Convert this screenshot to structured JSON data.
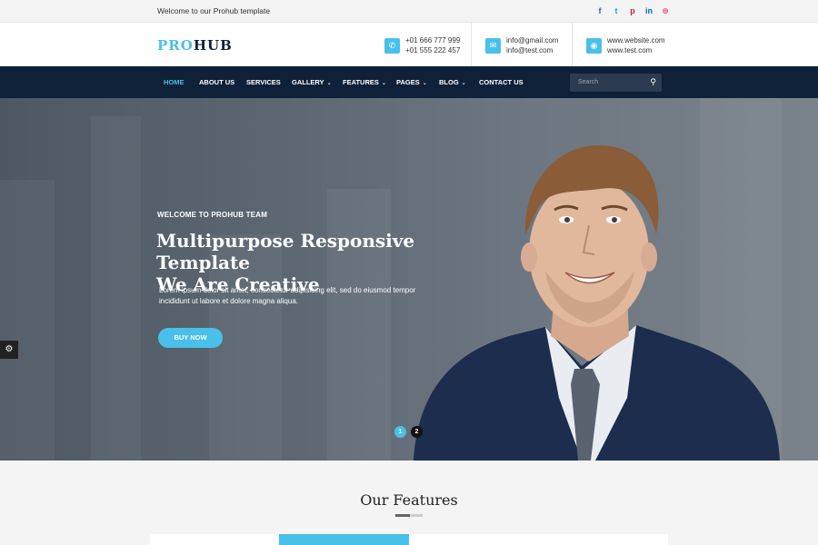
{
  "topbar": {
    "welcome": "Welcome to our Prohub template",
    "social_icons": [
      "facebook-icon",
      "twitter-icon",
      "pinterest-icon",
      "linkedin-icon",
      "dribbble-icon"
    ]
  },
  "header": {
    "logo_pro": "PRO",
    "logo_hub": "HUB",
    "phones": [
      "+01 666 777 999",
      "+01 555 222 457"
    ],
    "emails": [
      "info@gmail.com",
      "info@test.com"
    ],
    "websites": [
      "www.website.com",
      "www.test.com"
    ]
  },
  "nav": {
    "items": [
      "HOME",
      "ABOUT US",
      "SERVICES",
      "GALLERY",
      "FEATURES",
      "PAGES",
      "BLOG",
      "CONTACT US"
    ],
    "search_placeholder": "Search"
  },
  "hero": {
    "kicker": "WELCOME TO PROHUB TEAM",
    "title_line1": "Multipurpose Responsive Template",
    "title_line2": "We Are Creative",
    "desc": "Lorem ipsum dolor sit amet, consectetur adipisicing elit, sed do eiusmod tempor incididunt ut labore et dolore magna aliqua.",
    "button": "BUY NOW",
    "slides": [
      "1",
      "2"
    ]
  },
  "features": {
    "title": "Our Features"
  },
  "colors": {
    "accent": "#49c0e9",
    "navy": "#0e2139"
  }
}
